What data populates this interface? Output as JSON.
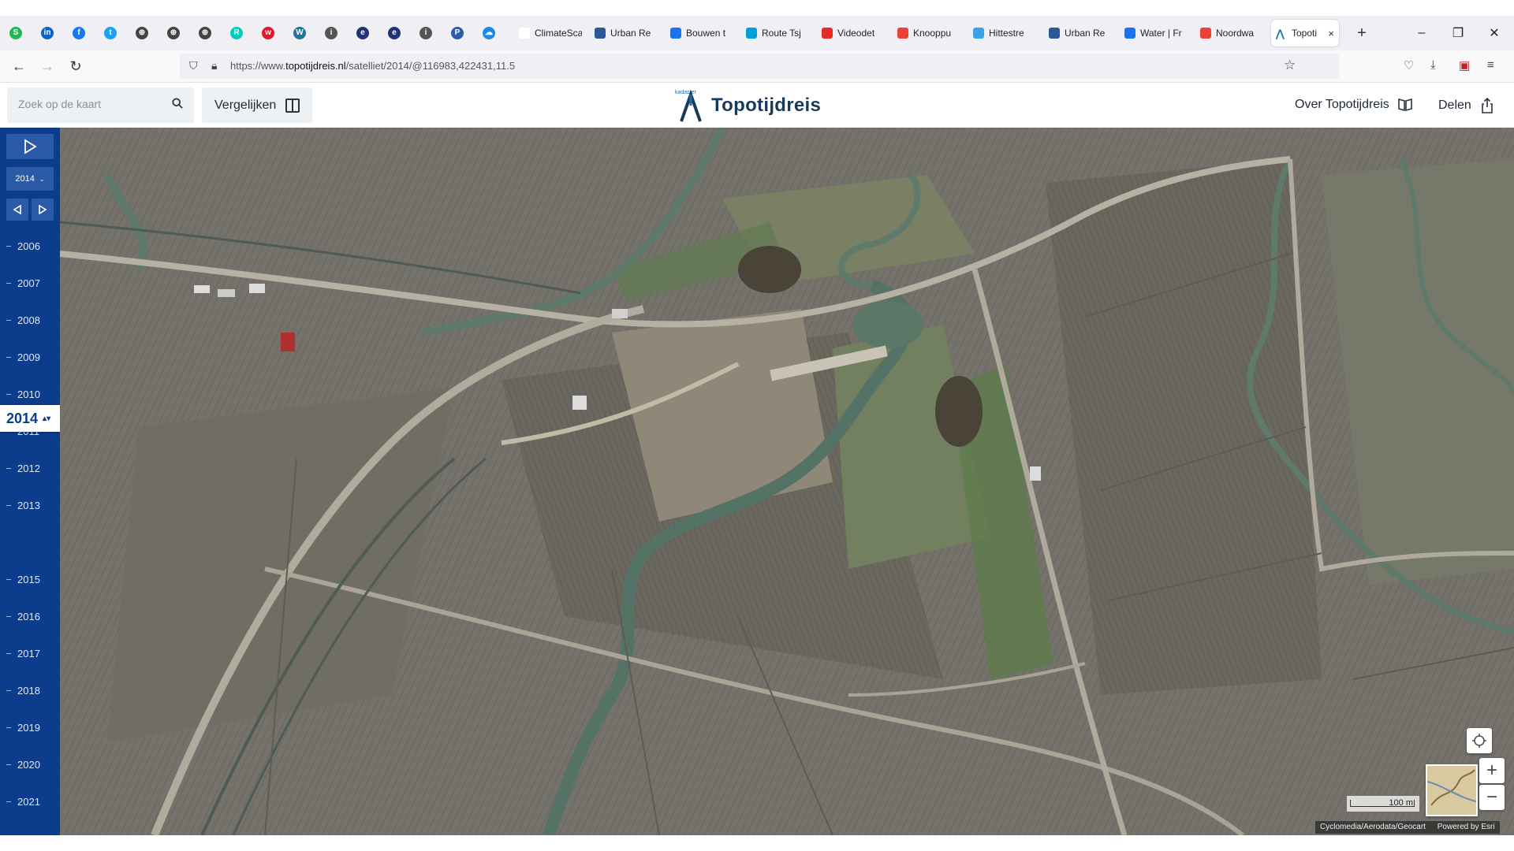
{
  "browser": {
    "pinned_icons": [
      {
        "name": "spotify-icon",
        "color": "#1db954",
        "glyph": "S"
      },
      {
        "name": "linkedin-icon",
        "color": "#0a66c2",
        "glyph": "in"
      },
      {
        "name": "facebook-icon",
        "color": "#1877f2",
        "glyph": "f"
      },
      {
        "name": "twitter-icon",
        "color": "#1da1f2",
        "glyph": "t"
      },
      {
        "name": "globe-icon",
        "color": "#444444",
        "glyph": "⊕"
      },
      {
        "name": "globe-icon",
        "color": "#444444",
        "glyph": "⊕"
      },
      {
        "name": "globe-icon",
        "color": "#444444",
        "glyph": "⊕"
      },
      {
        "name": "researchgate-icon",
        "color": "#00ccbb",
        "glyph": "R"
      },
      {
        "name": "weibo-icon",
        "color": "#e6162d",
        "glyph": "w"
      },
      {
        "name": "wordpress-icon",
        "color": "#21759b",
        "glyph": "W"
      },
      {
        "name": "info-icon",
        "color": "#555555",
        "glyph": "i"
      },
      {
        "name": "app-icon",
        "color": "#223377",
        "glyph": "e"
      },
      {
        "name": "app-icon",
        "color": "#223377",
        "glyph": "e"
      },
      {
        "name": "info-icon",
        "color": "#555555",
        "glyph": "i"
      },
      {
        "name": "p-icon",
        "color": "#2d5da8",
        "glyph": "P"
      },
      {
        "name": "cloud-icon",
        "color": "#1e88e5",
        "glyph": "☁"
      }
    ],
    "tabs": [
      {
        "label": "ClimateScan",
        "color": "#ffffff"
      },
      {
        "label": "Urban Re",
        "color": "#2b5797"
      },
      {
        "label": "Bouwen t",
        "color": "#1a73e8"
      },
      {
        "label": "Route Tsj",
        "color": "#00a0d6"
      },
      {
        "label": "Videodet",
        "color": "#e52d27"
      },
      {
        "label": "Knooppu",
        "color": "#ea4335"
      },
      {
        "label": "Hittestre",
        "color": "#3aa3e3"
      },
      {
        "label": "Urban Re",
        "color": "#2b5797"
      },
      {
        "label": "Water | Fr",
        "color": "#1a73e8"
      },
      {
        "label": "Noordwa",
        "color": "#ea4335"
      }
    ],
    "active_tab": {
      "label": "Topoti",
      "close": "×"
    },
    "new_tab": "+",
    "window": {
      "minimize": "–",
      "restore": "❐",
      "close": "✕"
    },
    "url": {
      "prefix": "https://www.",
      "host": "topotijdreis.nl",
      "path": "/satelliet/2014/@116983,422431,11.5"
    }
  },
  "header": {
    "search": {
      "placeholder": "Zoek op de kaart"
    },
    "compare_label": "Vergelijken",
    "logo": {
      "small": "kadaster",
      "title": "Topotijdreis",
      "accent": "#1b6fa8"
    },
    "about_label": "Over Topotijdreis",
    "share_label": "Delen"
  },
  "timeline": {
    "selected_year": "2014",
    "years": [
      "2006",
      "2007",
      "2008",
      "2009",
      "2010",
      "2011",
      "2012",
      "2013",
      "2014",
      "2015",
      "2016",
      "2017",
      "2018",
      "2019",
      "2020",
      "2021"
    ],
    "background": "#0c3c8c"
  },
  "map": {
    "scale_label": "100 m",
    "attribution": "Cyclomedia/Aerodata/Geocart",
    "powered_by": "Powered by Esri"
  }
}
